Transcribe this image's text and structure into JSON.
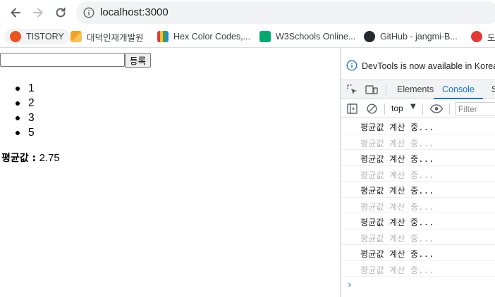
{
  "browser": {
    "url": "localhost:3000",
    "bookmarks": [
      {
        "label": "TISTORY",
        "color": "#eb531f"
      },
      {
        "label": "대덕인재개발원",
        "color": "#f4a21e"
      },
      {
        "label": "Hex Color Codes,...",
        "color": "#6a4bc4"
      },
      {
        "label": "W3Schools Online...",
        "color": "#04aa6d"
      },
      {
        "label": "GitHub - jangmi-B...",
        "color": "#24292f"
      },
      {
        "label": "도",
        "color": "#e53935"
      }
    ]
  },
  "page": {
    "input_value": "",
    "register_button": "등록",
    "numbers": [
      "1",
      "2",
      "3",
      "5"
    ],
    "average_label": "평균값 :",
    "average_value": "2.75"
  },
  "devtools": {
    "notice": "DevTools is now available in Korean!",
    "tabs": [
      "Elements",
      "Console",
      "S"
    ],
    "active_tab": "Console",
    "context": "top",
    "filter_placeholder": "Filter",
    "logs": [
      {
        "text": "평균값 계산 중...",
        "faded": false
      },
      {
        "text": "평균값 계산 중...",
        "faded": true
      },
      {
        "text": "평균값 계산 중...",
        "faded": false
      },
      {
        "text": "평균값 계산 중...",
        "faded": true
      },
      {
        "text": "평균값 계산 중...",
        "faded": false
      },
      {
        "text": "평균값 계산 중...",
        "faded": true
      },
      {
        "text": "평균값 계산 중...",
        "faded": false
      },
      {
        "text": "평균값 계산 중...",
        "faded": true
      },
      {
        "text": "평균값 계산 중...",
        "faded": false
      },
      {
        "text": "평균값 계산 중...",
        "faded": true
      }
    ],
    "prompt_symbol": "›"
  }
}
